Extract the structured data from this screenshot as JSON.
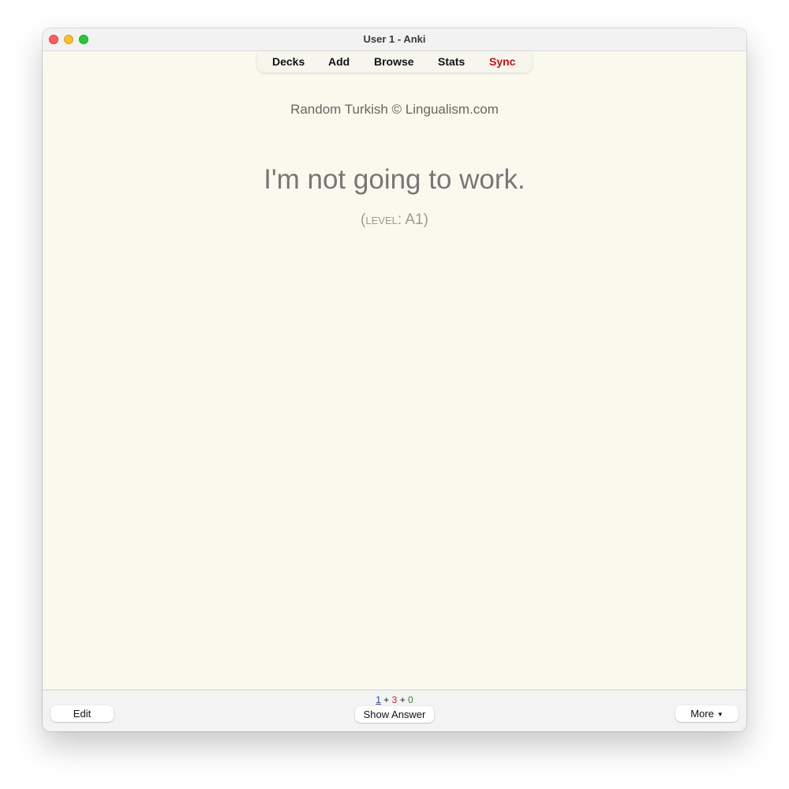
{
  "window": {
    "title": "User 1 - Anki"
  },
  "toolbar": {
    "items": [
      {
        "label": "Decks"
      },
      {
        "label": "Add"
      },
      {
        "label": "Browse"
      },
      {
        "label": "Stats"
      },
      {
        "label": "Sync"
      }
    ],
    "sync_color": "#cc1111"
  },
  "card": {
    "deck_attribution": "Random Turkish © Lingualism.com",
    "front_text": "I'm not going to work.",
    "level_label": "level",
    "level_value": "A1"
  },
  "bottom_bar": {
    "counts": {
      "new": "1",
      "learning": "3",
      "review": "0",
      "separator": "+"
    },
    "edit_label": "Edit",
    "show_answer_label": "Show Answer",
    "more_label": "More",
    "more_icon": "caret-down-icon"
  },
  "colors": {
    "card_background": "#f9f9ed",
    "new_count": "#1a3fb5",
    "learning_count": "#c62828",
    "review_count": "#2e8b2e"
  }
}
